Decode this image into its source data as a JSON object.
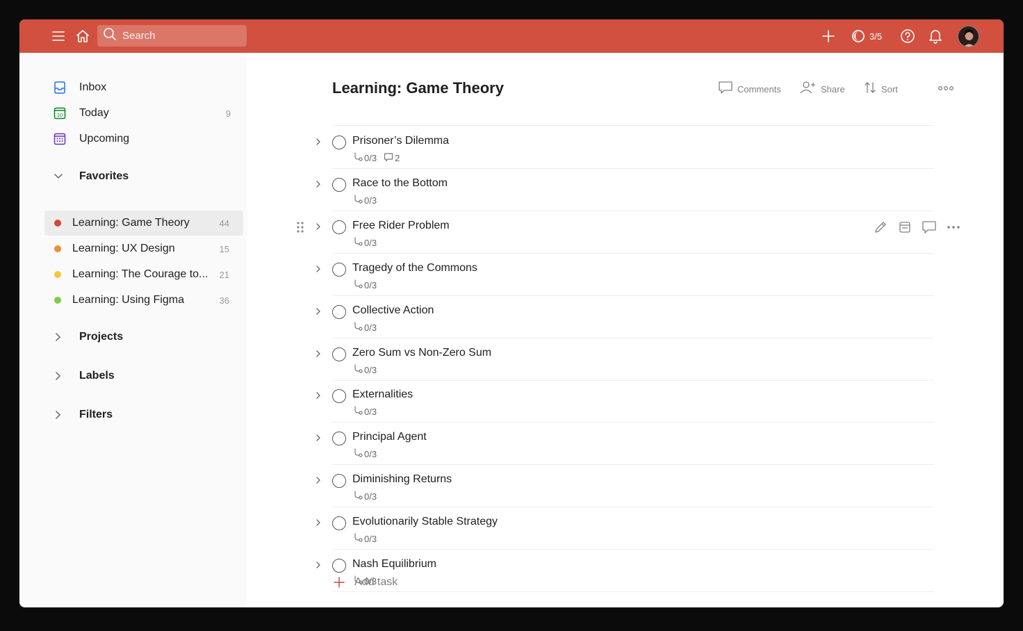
{
  "colors": {
    "brand": "#d1503f",
    "fav_red": "#d1453b",
    "fav_orange": "#eb8f38",
    "fav_yellow": "#f0c93d",
    "fav_green": "#7ecc49"
  },
  "topbar": {
    "search_placeholder": "Search",
    "karma": "3/5",
    "icons": [
      "menu-icon",
      "home-icon",
      "search-icon",
      "plus-icon",
      "karma-icon",
      "help-icon",
      "bell-icon"
    ]
  },
  "sidebar": {
    "nav": [
      {
        "label": "Inbox",
        "count": "",
        "icon": "inbox-icon"
      },
      {
        "label": "Today",
        "count": "9",
        "icon": "calendar-today-icon"
      },
      {
        "label": "Upcoming",
        "count": "",
        "icon": "calendar-upcoming-icon"
      }
    ],
    "favorites_label": "Favorites",
    "favorites": [
      {
        "label": "Learning: Game Theory",
        "count": "44",
        "color": "#d1453b"
      },
      {
        "label": "Learning: UX Design",
        "count": "15",
        "color": "#eb8f38"
      },
      {
        "label": "Learning: The Courage to...",
        "count": "21",
        "color": "#f0c93d"
      },
      {
        "label": "Learning: Using Figma",
        "count": "36",
        "color": "#7ecc49"
      }
    ],
    "projects_label": "Projects",
    "labels_label": "Labels",
    "filters_label": "Filters"
  },
  "main": {
    "title": "Learning: Game Theory",
    "actions": {
      "comments": "Comments",
      "share": "Share",
      "sort": "Sort"
    },
    "tasks": [
      {
        "name": "Prisoner’s Dilemma",
        "subtasks": "0/3",
        "comments": "2"
      },
      {
        "name": "Race to the Bottom",
        "subtasks": "0/3"
      },
      {
        "name": "Free Rider Problem",
        "subtasks": "0/3"
      },
      {
        "name": "Tragedy of the Commons",
        "subtasks": "0/3"
      },
      {
        "name": "Collective Action",
        "subtasks": "0/3"
      },
      {
        "name": "Zero Sum vs Non-Zero Sum",
        "subtasks": "0/3"
      },
      {
        "name": "Externalities",
        "subtasks": "0/3"
      },
      {
        "name": "Principal Agent",
        "subtasks": "0/3"
      },
      {
        "name": "Diminishing Returns",
        "subtasks": "0/3"
      },
      {
        "name": "Evolutionarily Stable Strategy",
        "subtasks": "0/3"
      },
      {
        "name": "Nash Equilibrium",
        "subtasks": "0/3"
      }
    ],
    "add_task": "Add task"
  }
}
